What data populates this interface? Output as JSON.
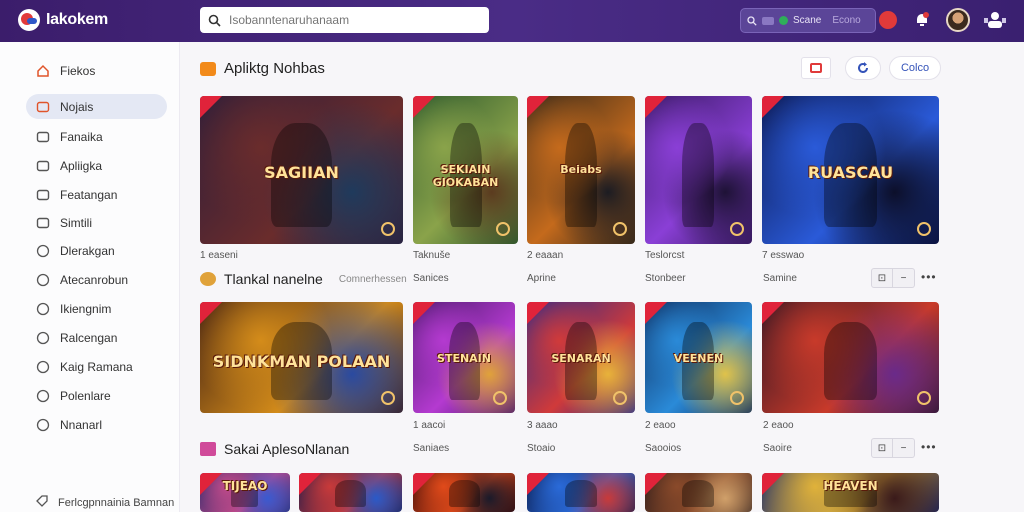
{
  "app": {
    "name": "Iakokem"
  },
  "search": {
    "placeholder": "Isobanntenaruhanaam"
  },
  "pill": {
    "text": "Scane",
    "sub": "Econo"
  },
  "icons": {
    "search": "search-icon",
    "bell": "bell-icon",
    "user": "user-icon",
    "home": "home-icon"
  },
  "sidebar": {
    "items": [
      {
        "label": "Fiekos",
        "icon": "home-icon"
      },
      {
        "label": "Nojais",
        "icon": "image-icon"
      },
      {
        "label": "Fanaika",
        "icon": "card-icon"
      },
      {
        "label": "Apliigka",
        "icon": "grid-icon"
      },
      {
        "label": "Featangan",
        "icon": "monitor-icon"
      },
      {
        "label": "Simtili",
        "icon": "sparkle-icon"
      },
      {
        "label": "Dlerakgan",
        "icon": "heart-icon"
      },
      {
        "label": "Atecanrobun",
        "icon": "globe-icon"
      },
      {
        "label": "Ikiengnim",
        "icon": "globe-icon"
      },
      {
        "label": "Ralcengan",
        "icon": "book-icon"
      },
      {
        "label": "Kaig Ramana",
        "icon": "bookmark-icon"
      },
      {
        "label": "Polenlare",
        "icon": "circle-icon"
      },
      {
        "label": "Nnanarl",
        "icon": "circle-icon"
      }
    ],
    "footer": "Ferlcgpnnainia Bamnan"
  },
  "header_buttons": {
    "primary": "Colco"
  },
  "sections": [
    {
      "title": "Apliktg Nohbas",
      "cards": [
        {
          "art": "SAGIIAN",
          "meta": "1 easeni",
          "colors": [
            "#2b1d3a",
            "#6a2c2c",
            "#1f3a5c"
          ]
        },
        {
          "art": "SEKIAIN GIOKABAN",
          "meta": "Taknuše",
          "colors": [
            "#2f5a2e",
            "#8aa34a",
            "#5b3b1f"
          ]
        },
        {
          "art": "Beiabs",
          "meta": "2 eaaan",
          "colors": [
            "#3a2a1a",
            "#c46a1c",
            "#1c1c22"
          ]
        },
        {
          "art": "",
          "meta": "Teslorcst",
          "colors": [
            "#3b1b66",
            "#8a3fd6",
            "#1e1236"
          ]
        },
        {
          "art": "RUASCAU",
          "meta": "7 esswao",
          "colors": [
            "#0a1446",
            "#2a5ad8",
            "#0c0f2a"
          ]
        }
      ]
    },
    {
      "title": "Tlankal nanelne",
      "sub": "Comnerhessen",
      "meta_row": [
        "Sanices",
        "Aprine",
        "Stonbeer",
        "Samine"
      ],
      "cards": [
        {
          "art": "SIDNKMAN POLAAN",
          "colors": [
            "#3a1a12",
            "#d48c1a",
            "#2a4aa0"
          ]
        },
        {
          "art": "STENAIN",
          "colors": [
            "#4a1a6a",
            "#b43ad0",
            "#e0a23a"
          ]
        },
        {
          "art": "SENARAN",
          "colors": [
            "#2b2a8a",
            "#d03a3a",
            "#e8b23a"
          ]
        },
        {
          "art": "VEENEN",
          "colors": [
            "#0e2a5a",
            "#2a8ad8",
            "#e0c24a"
          ]
        },
        {
          "art": "",
          "colors": [
            "#2a1424",
            "#c83a2a",
            "#6a2a8a"
          ]
        }
      ]
    },
    {
      "title": "Sakai AplesoNlanan",
      "meta_row": [
        "1 aacoi",
        "Saniaes",
        "3 aaao",
        "Stoaio",
        "2 eaoo",
        "Saooios",
        "2 eaoo",
        "Saoire"
      ],
      "cards": [
        {
          "art": "TIJEAO",
          "colors": [
            "#2a2a6a",
            "#c04a8a",
            "#3a5ad0"
          ]
        },
        {
          "art": "",
          "colors": [
            "#1a1a4a",
            "#c83a3a",
            "#2a5ac8"
          ]
        },
        {
          "art": "",
          "colors": [
            "#3a0a0a",
            "#e04a1a",
            "#1a1a2a"
          ]
        },
        {
          "art": "",
          "colors": [
            "#0a1a4a",
            "#2a6ad8",
            "#c83a3a"
          ]
        },
        {
          "art": "",
          "colors": [
            "#2a1a1a",
            "#8a4a2a",
            "#d0a06a"
          ]
        },
        {
          "art": "HEAVEN",
          "colors": [
            "#1a2a6a",
            "#e0b23a",
            "#3a1a1a"
          ]
        }
      ]
    }
  ],
  "section_meta": {
    "row1": [
      "1 easeni",
      "Taknuše",
      "2 eaaan",
      "Teslorcst",
      "7 esswao"
    ],
    "row2": [
      "1 aacoi",
      "3 aaao",
      "2 eaoo",
      "2 eaoo"
    ],
    "row2b": [
      "Saniaes",
      "Stoaio",
      "Saooios",
      "Saoire"
    ]
  },
  "controls": {
    "box": "⊡",
    "minus": "−",
    "more": "•••"
  },
  "accent": "#3b1d6b",
  "danger": "#e03a3a"
}
